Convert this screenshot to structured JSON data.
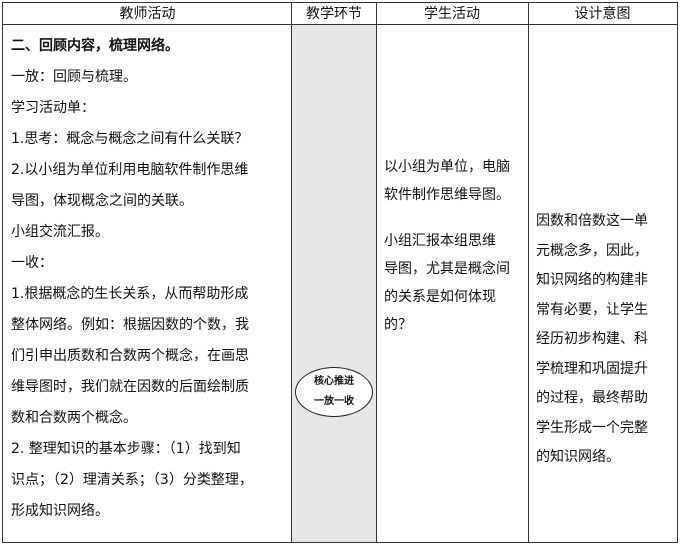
{
  "headers": {
    "teacher": "教师活动",
    "stage": "教学环节",
    "student": "学生活动",
    "intent": "设计意图"
  },
  "teacher_lines": [
    "二、回顾内容，梳理网络。",
    "一放：回顾与梳理。",
    "学习活动单：",
    "1.思考：概念与概念之间有什么关联？",
    "2.以小组为单位利用电脑软件制作思维",
    "导图，体现概念之间的关联。",
    "小组交流汇报。",
    "一收：",
    "1.根据概念的生长关系，从而帮助形成",
    "整体网络。例如：根据因数的个数，我",
    "们引申出质数和合数两个概念，在画思",
    "维导图时，我们就在因数的后面绘制质",
    "数和合数两个概念。",
    "2. 整理知识的基本步骤：（1）找到知",
    "识点；（2）理清关系；（3）分类整理，",
    "形成知识网络。"
  ],
  "stage": {
    "line1": "核心推进",
    "line2": "一放一收"
  },
  "student_block1": [
    "以小组为单位，电脑",
    "软件制作思维导图。"
  ],
  "student_block2": [
    "小组汇报本组思维",
    "导图，尤其是概念间",
    "的关系是如何体现",
    "的？"
  ],
  "intent_lines": [
    "因数和倍数这一单",
    "元概念多，因此，",
    "知识网络的构建非",
    "常有必要，让学生",
    "经历初步构建、科",
    "学梳理和巩固提升",
    "的过程，最终帮助",
    "学生形成一个完整",
    "的知识网络。"
  ]
}
